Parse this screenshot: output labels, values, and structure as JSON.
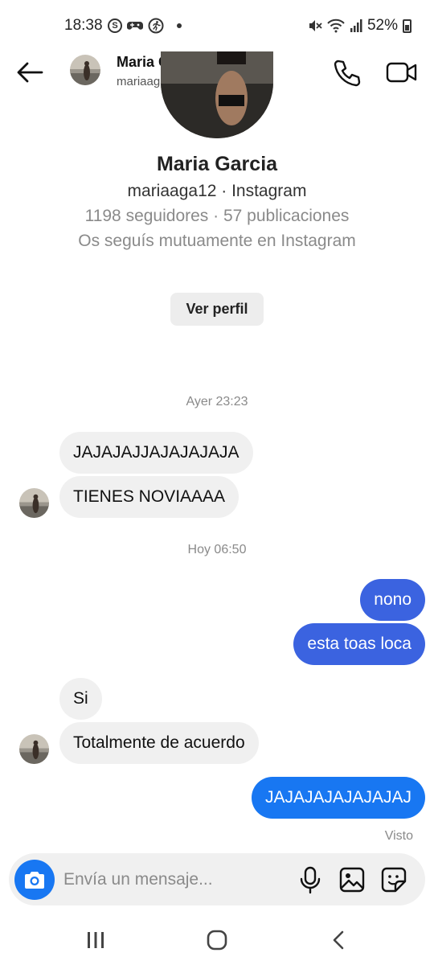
{
  "status_bar": {
    "time": "18:38",
    "battery": "52%",
    "icons": [
      "s-icon",
      "game-controller-icon",
      "running-icon",
      "dot-icon",
      "mute-icon",
      "wifi-icon",
      "signal-icon",
      "battery-icon"
    ]
  },
  "header": {
    "name": "Maria Garcia",
    "username": "mariaaga12"
  },
  "profile": {
    "name": "Maria Garcia",
    "subtitle": "mariaaga12 · Instagram",
    "stats": "1198 seguidores · 57 publicaciones",
    "mutual": "Os seguís mutuamente en Instagram",
    "view_profile_label": "Ver perfil"
  },
  "conversation": {
    "timestamp_1": "Ayer 23:23",
    "timestamp_2": "Hoy 06:50",
    "messages": [
      {
        "from": "them",
        "text": "JAJAJAJJAJAJAJAJA"
      },
      {
        "from": "them",
        "text": "TIENES NOVIAAAA"
      },
      {
        "from": "me",
        "text": "nono"
      },
      {
        "from": "me",
        "text": "esta toas loca"
      },
      {
        "from": "them",
        "text": "Si"
      },
      {
        "from": "them",
        "text": "Totalmente de acuerdo"
      },
      {
        "from": "me",
        "text": "JAJAJAJAJAJAJAJ"
      }
    ],
    "seen_label": "Visto"
  },
  "composer": {
    "placeholder": "Envía un mensaje..."
  },
  "colors": {
    "outgoing_bubble": "#3b63e0",
    "outgoing_bubble_latest": "#1877f2",
    "incoming_bubble": "#f0f0f0",
    "camera_button": "#1877f2"
  }
}
